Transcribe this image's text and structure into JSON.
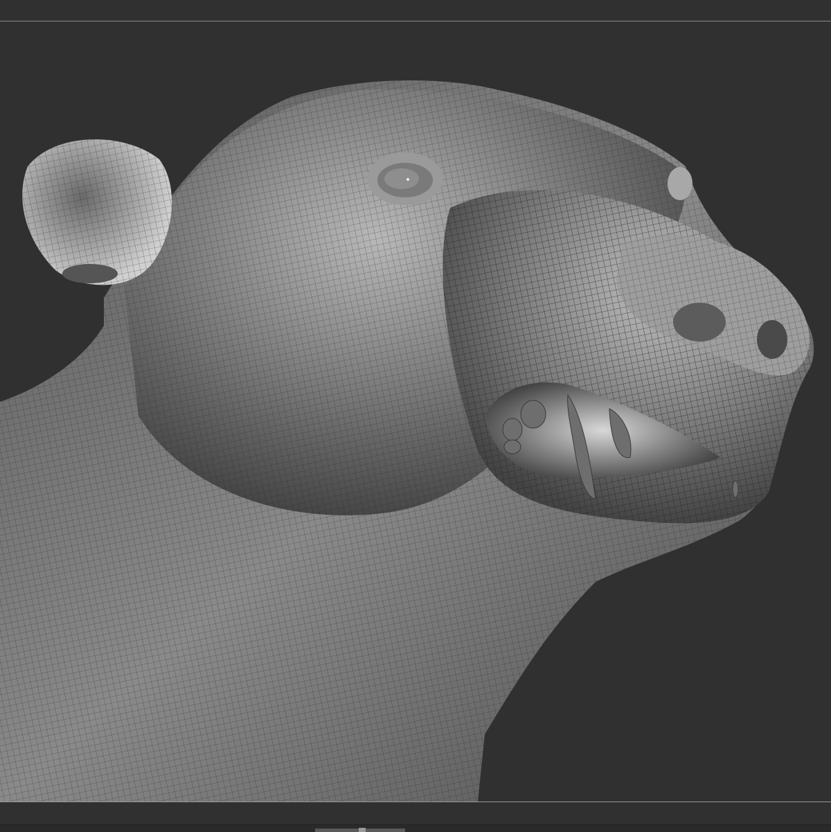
{
  "viewport": {
    "background_color": "#303030",
    "model_base_color": "#8c8c8c",
    "wire_color": "#2a2a2a",
    "guide_color": "#8a8a8a"
  },
  "icons": {
    "scroll_thumb": "scrollbar-thumb"
  }
}
